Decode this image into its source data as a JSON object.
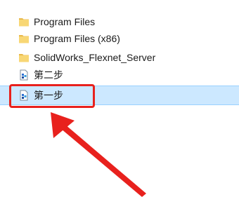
{
  "files": [
    {
      "label": "Program Files",
      "icon": "folder-icon"
    },
    {
      "label": "Program Files (x86)",
      "icon": "folder-icon"
    },
    {
      "label": "SolidWorks_Flexnet_Server",
      "icon": "folder-icon"
    },
    {
      "label": "第二步",
      "icon": "registry-file-icon"
    },
    {
      "label": "第一步",
      "icon": "registry-file-icon",
      "selected": true
    }
  ],
  "colors": {
    "selection_bg": "#cce8ff",
    "selection_border": "#99d1ff",
    "annotation_red": "#e8211d",
    "folder_yellow": "#f8d775"
  }
}
